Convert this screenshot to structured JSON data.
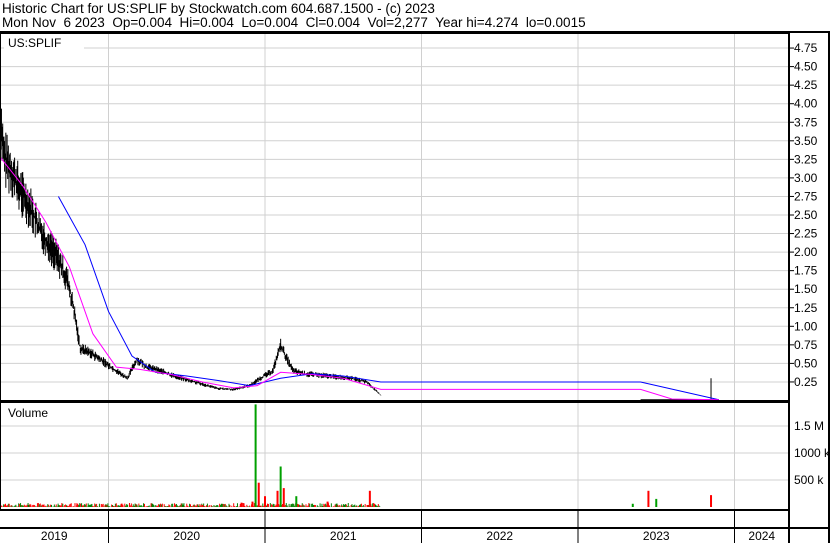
{
  "header": {
    "line1": "Historic Chart for US:SPLIF by Stockwatch.com 604.687.1500 - (c) 2023",
    "line2": "Mon Nov  6 2023  Op=0.004  Hi=0.004  Lo=0.004  Cl=0.004  Vol=2,277  Year hi=4.274  lo=0.0015"
  },
  "chart_data": {
    "type": "line",
    "symbol": "US:SPLIF",
    "volume_label": "Volume",
    "price_ticks": [
      0.25,
      0.5,
      0.75,
      1.0,
      1.25,
      1.5,
      1.75,
      2.0,
      2.25,
      2.5,
      2.75,
      3.0,
      3.25,
      3.5,
      3.75,
      4.0,
      4.25,
      4.5,
      4.75
    ],
    "price_tick_labels": [
      "0.25",
      "0.50",
      "0.75",
      "1.00",
      "1.25",
      "1.50",
      "1.75",
      "2.00",
      "2.25",
      "2.50",
      "2.75",
      "3.00",
      "3.25",
      "3.50",
      "3.75",
      "4.00",
      "4.25",
      "4.50",
      "4.75"
    ],
    "volume_ticks": [
      500000,
      1000000,
      1500000
    ],
    "volume_tick_labels": [
      "500 k",
      "1000 k",
      "1.5 M"
    ],
    "years": [
      "2019",
      "2020",
      "2021",
      "2022",
      "2023",
      "2024"
    ],
    "ylim": [
      0,
      4.8
    ],
    "price": {
      "x": [
        2019.3,
        2019.33,
        2019.38,
        2019.43,
        2019.5,
        2019.56,
        2019.62,
        2019.68,
        2019.74,
        2019.78,
        2019.82,
        2019.88,
        2019.95,
        2020.05,
        2020.12,
        2020.18,
        2020.25,
        2020.33,
        2020.42,
        2020.5,
        2020.6,
        2020.7,
        2020.8,
        2020.9,
        2020.97,
        2021.05,
        2021.1,
        2021.13,
        2021.18,
        2021.25,
        2021.35,
        2021.45,
        2021.55,
        2021.65,
        2021.7,
        2021.74,
        2023.4,
        2023.6,
        2023.8,
        2023.9
      ],
      "close": [
        4.1,
        3.3,
        3.1,
        2.85,
        2.6,
        2.3,
        2.1,
        1.9,
        1.6,
        1.2,
        0.7,
        0.65,
        0.55,
        0.4,
        0.3,
        0.55,
        0.45,
        0.4,
        0.33,
        0.28,
        0.22,
        0.16,
        0.15,
        0.2,
        0.3,
        0.4,
        0.75,
        0.6,
        0.4,
        0.36,
        0.34,
        0.32,
        0.3,
        0.25,
        0.15,
        0.07,
        0.01,
        0.01,
        0.01,
        0.01
      ]
    },
    "ma_long": {
      "x": [
        2019.68,
        2019.85,
        2020.0,
        2020.15,
        2020.3,
        2020.5,
        2020.7,
        2020.9,
        2021.1,
        2021.3,
        2021.5,
        2021.74,
        2023.4,
        2023.9
      ],
      "y": [
        2.75,
        2.1,
        1.2,
        0.6,
        0.38,
        0.33,
        0.27,
        0.2,
        0.3,
        0.36,
        0.33,
        0.25,
        0.25,
        0.01
      ]
    },
    "ma_short": {
      "x": [
        2019.3,
        2019.45,
        2019.6,
        2019.75,
        2019.9,
        2020.05,
        2020.2,
        2020.4,
        2020.6,
        2020.8,
        2020.95,
        2021.1,
        2021.3,
        2021.5,
        2021.74,
        2023.4,
        2023.6,
        2023.9
      ],
      "y": [
        3.3,
        2.9,
        2.4,
        1.8,
        0.9,
        0.45,
        0.42,
        0.35,
        0.25,
        0.17,
        0.2,
        0.38,
        0.35,
        0.3,
        0.15,
        0.15,
        0.02,
        0.01
      ]
    },
    "spike": {
      "x": 2023.85,
      "high": 0.3
    },
    "volume": {
      "x": [
        2019.45,
        2019.8,
        2020.2,
        2020.6,
        2020.85,
        2020.92,
        2020.94,
        2020.96,
        2021.0,
        2021.08,
        2021.1,
        2021.12,
        2021.2,
        2021.4,
        2021.67,
        2023.35,
        2023.45,
        2023.5,
        2023.85
      ],
      "values": [
        30000,
        40000,
        30000,
        40000,
        80000,
        100000,
        1900000,
        450000,
        200000,
        300000,
        750000,
        350000,
        200000,
        100000,
        300000,
        60000,
        300000,
        150000,
        220000
      ],
      "up": [
        true,
        false,
        true,
        false,
        false,
        false,
        true,
        false,
        false,
        false,
        true,
        false,
        true,
        false,
        false,
        true,
        false,
        true,
        false
      ]
    }
  }
}
